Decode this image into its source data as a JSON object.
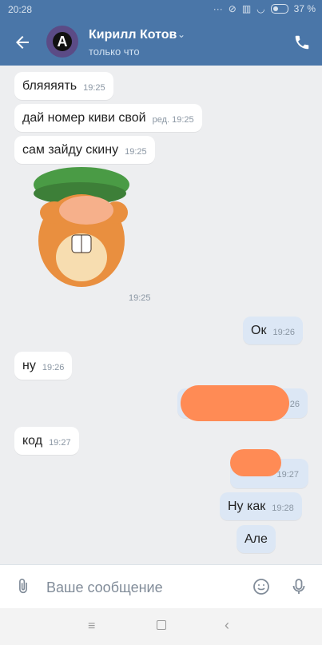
{
  "status": {
    "time": "20:28",
    "battery": "37 %"
  },
  "header": {
    "name": "Кирилл Котов",
    "subtitle": "только что"
  },
  "messages": {
    "m1": {
      "text": "бляяяять",
      "time": "19:25"
    },
    "m2": {
      "text": "дай номер киви свой",
      "time": "ред. 19:25"
    },
    "m3": {
      "text": "сам зайду скину",
      "time": "19:25"
    },
    "sticker_time": "19:25",
    "m4": {
      "text": "Ок",
      "time": "19:26"
    },
    "m5": {
      "text": "ну",
      "time": "19:26"
    },
    "m6": {
      "time": "26"
    },
    "m7": {
      "text": "код",
      "time": "19:27"
    },
    "m8": {
      "time": "19:27"
    },
    "m9": {
      "text": "Ну как",
      "time": "19:28"
    },
    "m10": {
      "text": "Але"
    }
  },
  "input": {
    "placeholder": "Ваше сообщение"
  },
  "icons": {
    "back": "arrow-left-icon",
    "call": "phone-icon",
    "attach": "paperclip-icon",
    "emoji": "smile-icon",
    "mic": "microphone-icon",
    "scroll": "chevron-down-icon",
    "nav_menu": "menu-icon",
    "nav_home": "square-home-icon",
    "nav_back": "triangle-back-icon"
  },
  "colors": {
    "header": "#4a76a8",
    "out_bubble": "#dce7f5",
    "in_bubble": "#ffffff",
    "redaction": "#ff8b55"
  }
}
